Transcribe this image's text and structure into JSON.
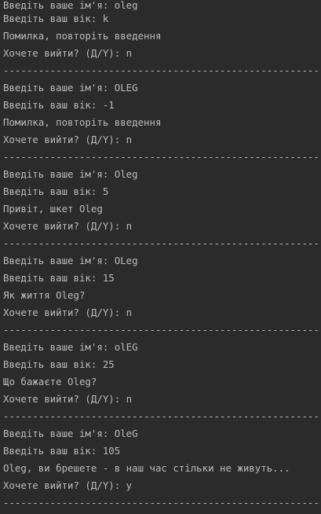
{
  "console": {
    "lines": [
      "Введіть ваше ім'я: oleg",
      "Введіть ваш вік: k",
      "Помилка, повторіть введення",
      "Хочете вийти? (Д/Y): n",
      "------------------------------------------------------",
      "Введіть ваше ім'я: OLEG",
      "Введіть ваш вік: -1",
      "Помилка, повторіть введення",
      "Хочете вийти? (Д/Y): n",
      "------------------------------------------------------",
      "Введіть ваше ім'я: Oleg",
      "Введіть ваш вік: 5",
      "Привіт, шкет Oleg",
      "Хочете вийти? (Д/Y): n",
      "------------------------------------------------------",
      "Введіть ваше ім'я: OLeg",
      "Введіть ваш вік: 15",
      "Як життя Oleg?",
      "Хочете вийти? (Д/Y): n",
      "------------------------------------------------------",
      "Введіть ваше ім'я: olEG",
      "Введіть ваш вік: 25",
      "Що бажаєте Oleg?",
      "Хочете вийти? (Д/Y): n",
      "------------------------------------------------------",
      "Введіть ваше ім'я: OleG",
      "Введіть ваш вік: 105",
      "Oleg, ви брешете - в наш час стільки не живуть...",
      "Хочете вийти? (Д/Y): y",
      "------------------------------------------------------"
    ]
  },
  "colors": {
    "background": "#2b2b2b",
    "text": "#bbbbbb"
  }
}
